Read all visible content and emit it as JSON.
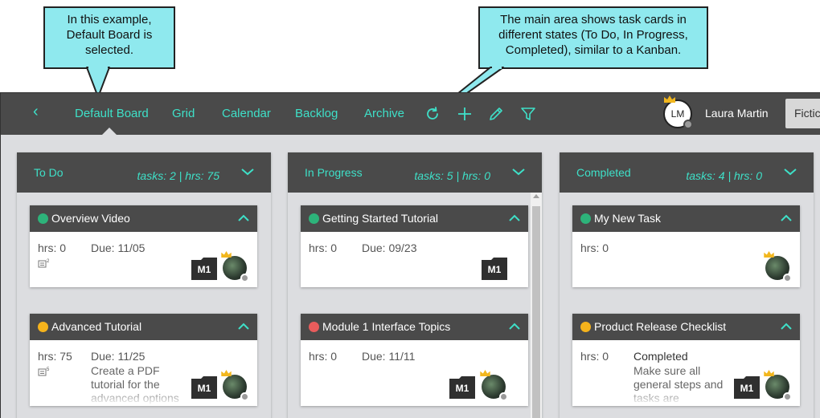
{
  "callouts": {
    "left": "In this example, Default Board is selected.",
    "right": "The main area shows task cards in different states (To Do, In Progress, Completed), similar to a Kanban."
  },
  "nav": {
    "back_icon": "chevron-left-icon",
    "items": [
      "Default Board",
      "Grid",
      "Calendar",
      "Backlog",
      "Archive"
    ],
    "active": "Default Board"
  },
  "tools": [
    "refresh-icon",
    "plus-icon",
    "pencil-icon",
    "filter-icon"
  ],
  "user": {
    "initials": "LM",
    "name": "Laura Martin"
  },
  "org_button": "Fictic",
  "colors": {
    "accent": "#3ee0c8",
    "bar": "#4a4a4a",
    "green": "#2db37a",
    "yellow": "#f5b31c",
    "red": "#e85c5c",
    "background": "#dcdde0",
    "callout": "#8fe9ee"
  },
  "columns": [
    {
      "title": "To Do",
      "stats": "tasks: 2 | hrs: 75",
      "cards": [
        {
          "title": "Overview Video",
          "status_color": "green",
          "hrs": "hrs: 0",
          "due": "Due: 11/05",
          "notes": "2",
          "project": "M1"
        },
        {
          "title": "Advanced Tutorial",
          "status_color": "yellow",
          "hrs": "hrs: 75",
          "due": "Due: 11/25",
          "notes": "5",
          "description": "Create a PDF tutorial for the advanced options",
          "project": "M1"
        }
      ]
    },
    {
      "title": "In Progress",
      "stats": "tasks: 5 | hrs: 0",
      "cards": [
        {
          "title": "Getting Started Tutorial",
          "status_color": "green",
          "hrs": "hrs: 0",
          "due": "Due: 09/23",
          "project": "M1"
        },
        {
          "title": "Module 1 Interface Topics",
          "status_color": "red",
          "hrs": "hrs: 0",
          "due": "Due: 11/11",
          "project": "M1"
        }
      ]
    },
    {
      "title": "Completed",
      "stats": "tasks: 4 | hrs: 0",
      "cards": [
        {
          "title": "My New Task",
          "status_color": "green",
          "hrs": "hrs: 0"
        },
        {
          "title": "Product Release Checklist",
          "status_color": "yellow",
          "hrs": "hrs: 0",
          "status": "Completed",
          "description": "Make sure all general steps and tasks are",
          "project": "M1"
        }
      ]
    }
  ]
}
